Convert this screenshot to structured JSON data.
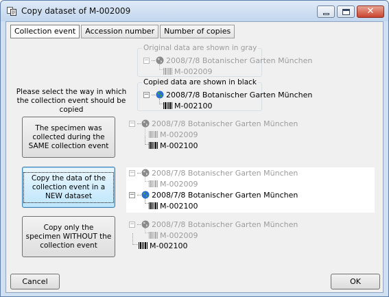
{
  "window": {
    "title": "Copy dataset of M-002009",
    "icon": "copy-dataset-icon"
  },
  "tabs": [
    {
      "label": "Collection event",
      "active": true
    },
    {
      "label": "Accession number",
      "active": false
    },
    {
      "label": "Number of copies",
      "active": false
    }
  ],
  "legend": {
    "original": "Original data are shown in gray",
    "copied": "Copied data are shown in black"
  },
  "instruction": "Please select the way in which the collection event should be copied",
  "tree": {
    "event_label": "2008/7/8 Botanischer Garten München",
    "original_specimen": "M-002009",
    "copied_specimen": "M-002100"
  },
  "options": [
    {
      "label": "The specimen was collected during the SAME collection event",
      "selected": false
    },
    {
      "label": "Copy the data of the collection event in a NEW dataset",
      "selected": true
    },
    {
      "label": "Copy only the specimen WITHOUT the collection event",
      "selected": false
    }
  ],
  "buttons": {
    "cancel": "Cancel",
    "ok": "OK"
  },
  "colors": {
    "original_text": "#9c9c9c",
    "copied_text": "#000000",
    "title_bar": "#c2d6ee"
  }
}
